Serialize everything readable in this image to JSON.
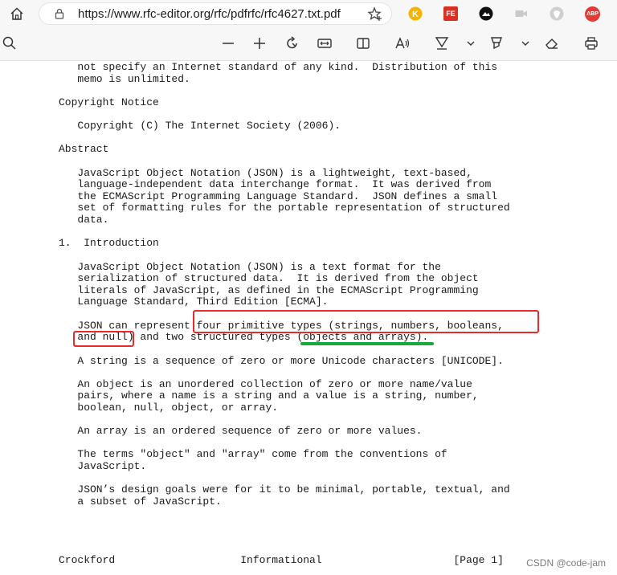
{
  "browser": {
    "url": "https://www.rfc-editor.org/rfc/pdfrfc/rfc4627.txt.pdf",
    "extensions": [
      "k-extension-icon",
      "fe-extension-icon",
      "dark-extension-icon",
      "camera-extension-icon",
      "shield-extension-icon",
      "adblock-plus-icon"
    ],
    "extension_labels": {
      "fe": "FE",
      "abp": "ABP"
    }
  },
  "pdf_toolbar": {
    "icons": [
      "search-icon",
      "zoom-out-icon",
      "zoom-in-icon",
      "rotate-icon",
      "fit-page-icon",
      "page-view-icon",
      "read-aloud-icon",
      "draw-icon",
      "draw-options-icon",
      "highlight-icon",
      "highlight-options-icon",
      "erase-icon",
      "print-icon"
    ]
  },
  "document": {
    "lines": [
      "   not specify an Internet standard of any kind.  Distribution of this",
      "   memo is unlimited.",
      "",
      "Copyright Notice",
      "",
      "   Copyright (C) The Internet Society (2006).",
      "",
      "Abstract",
      "",
      "   JavaScript Object Notation (JSON) is a lightweight, text-based,",
      "   language-independent data interchange format.  It was derived from",
      "   the ECMAScript Programming Language Standard.  JSON defines a small",
      "   set of formatting rules for the portable representation of structured",
      "   data.",
      "",
      "1.  Introduction",
      "",
      "   JavaScript Object Notation (JSON) is a text format for the",
      "   serialization of structured data.  It is derived from the object",
      "   literals of JavaScript, as defined in the ECMAScript Programming",
      "   Language Standard, Third Edition [ECMA].",
      "",
      "   JSON can represent four primitive types (strings, numbers, booleans,",
      "   and null) and two structured types (objects and arrays).",
      "",
      "   A string is a sequence of zero or more Unicode characters [UNICODE].",
      "",
      "   An object is an unordered collection of zero or more name/value",
      "   pairs, where a name is a string and a value is a string, number,",
      "   boolean, null, object, or array.",
      "",
      "   An array is an ordered sequence of zero or more values.",
      "",
      "   The terms \"object\" and \"array\" come from the conventions of",
      "   JavaScript.",
      "",
      "   JSON’s design goals were for it to be minimal, portable, textual, and",
      "   a subset of JavaScript.",
      "",
      "",
      "",
      "",
      "Crockford                    Informational                     [Page 1]"
    ]
  },
  "annotations": {
    "red_color": "#e52b2b",
    "green_color": "#19a83a"
  },
  "watermark": "CSDN @code-jam"
}
